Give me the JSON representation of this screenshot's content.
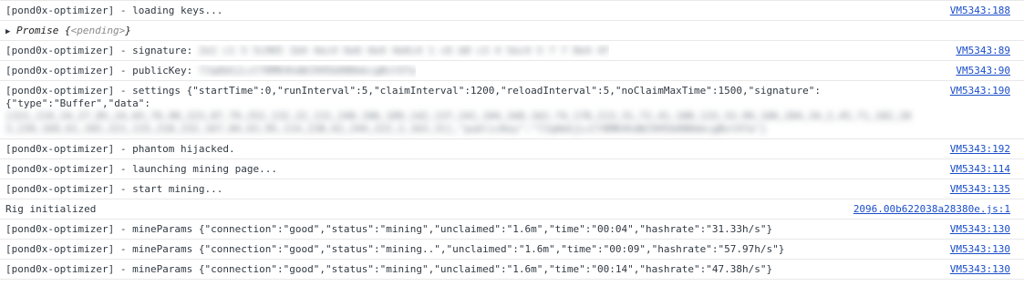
{
  "rows": [
    {
      "text": "[pond0x-optimizer] - loading keys...",
      "source": "VM5343:188"
    },
    {
      "promise_label": "Promise",
      "promise_open": "{",
      "promise_state": "<pending>",
      "promise_close": "}"
    },
    {
      "prefix": "[pond0x-optimizer] - signature:",
      "redacted": "2e1 c1 5 5c965 1b4 4ec4 6e6 6e4 4e6c4 1 c6 b8 c3 4 5ec4 5 7 7 8e4 4f",
      "source": "VM5343:89"
    },
    {
      "prefix": "[pond0x-optimizer] - publicKey:",
      "redacted": "7JqAbGjLcCY8MK4hdWJXH5b6N0mkcgBvtXfa",
      "source": "VM5343:90"
    },
    {
      "prefix": "[pond0x-optimizer] - settings {\"startTime\":0,\"runInterval\":5,\"claimInterval\":1200,\"reloadInterval\":5,\"noClaimMaxTime\":1500,\"signature\":",
      "line2": "{\"type\":\"Buffer\",\"data\":",
      "redacted": "[221,119,24,27,85,24,65,76,90,223,87,79,252,132,22,131,240,106,189,142,137,241,104,168,162,74,178,213,31,72,41,188,133,33,99,106,204,34,2,45,71,102,203,239,169,61,102,221,115,218,232,167,84,63,95,114,238,62,244,222,2,163,31],\"publicKey\":\"7JqAbGjLcCY8MK4hdWJXH5b6N0mkcgBvtXfa\"}",
      "source": "VM5343:190"
    },
    {
      "text": "[pond0x-optimizer] - phantom hijacked.",
      "source": "VM5343:192"
    },
    {
      "text": "[pond0x-optimizer] - launching mining page...",
      "source": "VM5343:114"
    },
    {
      "text": "[pond0x-optimizer] - start mining...",
      "source": "VM5343:135"
    },
    {
      "text": "Rig initialized",
      "source": "2096.00b622038a28380e.js:1"
    },
    {
      "text": "[pond0x-optimizer] - mineParams {\"connection\":\"good\",\"status\":\"mining\",\"unclaimed\":\"1.6m\",\"time\":\"00:04\",\"hashrate\":\"31.33h/s\"}",
      "source": "VM5343:130"
    },
    {
      "text": "[pond0x-optimizer] - mineParams {\"connection\":\"good\",\"status\":\"mining..\",\"unclaimed\":\"1.6m\",\"time\":\"00:09\",\"hashrate\":\"57.97h/s\"}",
      "source": "VM5343:130"
    },
    {
      "text": "[pond0x-optimizer] - mineParams {\"connection\":\"good\",\"status\":\"mining\",\"unclaimed\":\"1.6m\",\"time\":\"00:14\",\"hashrate\":\"47.38h/s\"}",
      "source": "VM5343:130"
    }
  ],
  "icons": {
    "expand": "triangle-right-icon"
  }
}
